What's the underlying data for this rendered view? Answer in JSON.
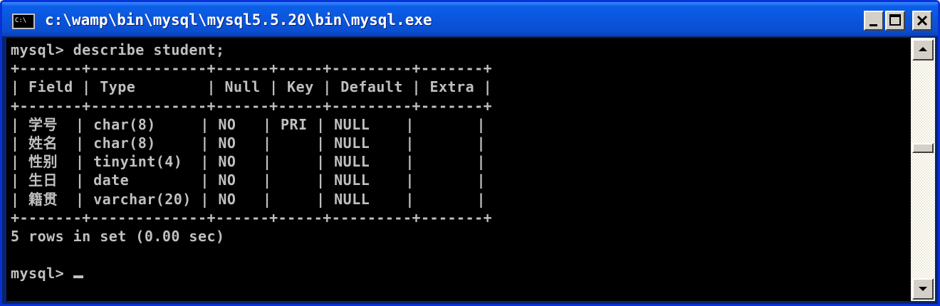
{
  "window": {
    "title": "c:\\wamp\\bin\\mysql\\mysql5.5.20\\bin\\mysql.exe",
    "icon_label": "C:\\",
    "icon": "console-app-icon",
    "controls": [
      "minimize-icon",
      "maximize-icon",
      "close-icon"
    ]
  },
  "console": {
    "lines": [
      "mysql> describe student;",
      "+-------+-------------+------+-----+---------+-------+",
      "| Field | Type        | Null | Key | Default | Extra |",
      "+-------+-------------+------+-----+---------+-------+",
      "| 学号  | char(8)     | NO   | PRI | NULL    |       |",
      "| 姓名  | char(8)     | NO   |     | NULL    |       |",
      "| 性别  | tinyint(4)  | NO   |     | NULL    |       |",
      "| 生日  | date        | NO   |     | NULL    |       |",
      "| 籍贯  | varchar(20) | NO   |     | NULL    |       |",
      "+-------+-------------+------+-----+---------+-------+",
      "5 rows in set (0.00 sec)",
      "",
      "mysql> "
    ],
    "text_color": "#C0C0C0",
    "background": "#000000"
  },
  "scrollbar": {
    "up_icon": "arrow-up-icon",
    "down_icon": "arrow-down-icon"
  },
  "colors": {
    "titlebar": "#0A54DB",
    "chrome": "#D4D0C8"
  }
}
